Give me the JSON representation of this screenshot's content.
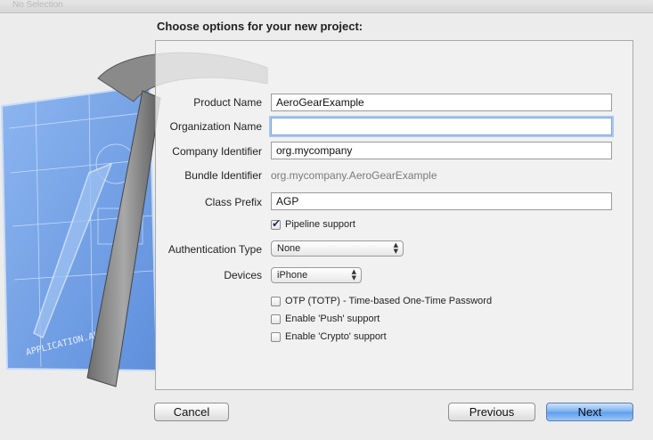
{
  "window": {
    "title": "No Selection"
  },
  "heading": "Choose options for your new project:",
  "fields": {
    "product_name": {
      "label": "Product Name",
      "value": "AeroGearExample"
    },
    "organization_name": {
      "label": "Organization Name",
      "value": ""
    },
    "company_identifier": {
      "label": "Company Identifier",
      "value": "org.mycompany"
    },
    "bundle_identifier": {
      "label": "Bundle Identifier",
      "value": "org.mycompany.AeroGearExample"
    },
    "class_prefix": {
      "label": "Class Prefix",
      "value": "AGP"
    }
  },
  "pipeline": {
    "label": "Pipeline support",
    "checked": true
  },
  "auth_type": {
    "label": "Authentication Type",
    "value": "None"
  },
  "devices": {
    "label": "Devices",
    "value": "iPhone"
  },
  "options": [
    {
      "label": "OTP (TOTP) - Time-based One-Time Password",
      "checked": false
    },
    {
      "label": "Enable 'Push' support",
      "checked": false
    },
    {
      "label": "Enable 'Crypto' support",
      "checked": false
    }
  ],
  "artwork": {
    "blueprint_text": "APPLICATION.APP"
  },
  "buttons": {
    "cancel": "Cancel",
    "previous": "Previous",
    "next": "Next"
  },
  "colors": {
    "blueprint": "#6f9ee6",
    "focus_ring": "#a8c8f0",
    "primary_button": "#6aa6ef"
  }
}
